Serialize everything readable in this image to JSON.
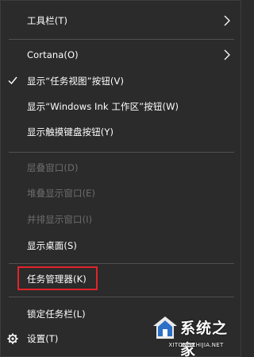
{
  "menu": {
    "items": [
      {
        "label": "工具栏(T)",
        "enabled": true,
        "submenu": true
      },
      {
        "label": "Cortana(O)",
        "enabled": true,
        "submenu": true
      },
      {
        "label": "显示“任务视图”按钮(V)",
        "enabled": true,
        "checked": true
      },
      {
        "label": "显示“Windows Ink 工作区”按钮(W)",
        "enabled": true
      },
      {
        "label": "显示触摸键盘按钮(Y)",
        "enabled": true
      },
      {
        "label": "层叠窗口(D)",
        "enabled": false
      },
      {
        "label": "堆叠显示窗口(E)",
        "enabled": false
      },
      {
        "label": "并排显示窗口(I)",
        "enabled": false
      },
      {
        "label": "显示桌面(S)",
        "enabled": true
      },
      {
        "label": "任务管理器(K)",
        "enabled": true,
        "highlighted": true
      },
      {
        "label": "锁定任务栏(L)",
        "enabled": true
      },
      {
        "label": "设置(T)",
        "enabled": true,
        "icon": "gear-icon"
      }
    ]
  },
  "watermark": {
    "title": "系统之家",
    "url": "XITONGZHIJIA.NET"
  },
  "colors": {
    "menu_background": "#2b2b2b",
    "text": "#ffffff",
    "disabled_text": "#6d6d6d",
    "separator": "#505050",
    "highlight_border": "#e0242a"
  }
}
